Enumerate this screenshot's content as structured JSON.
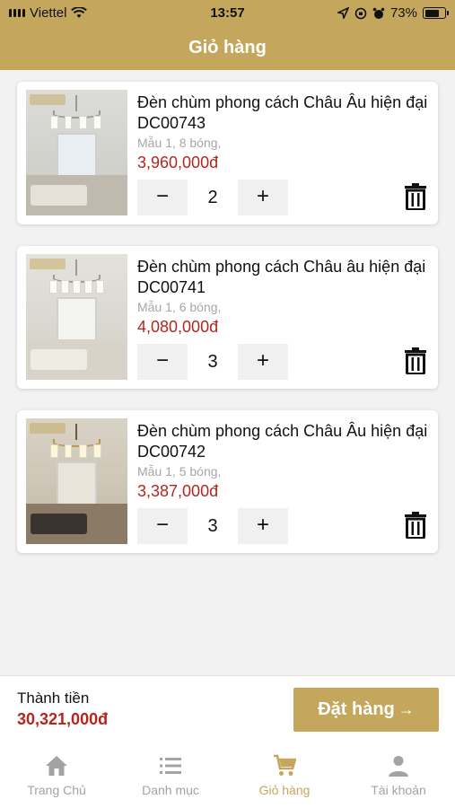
{
  "status": {
    "carrier": "Viettel",
    "time": "13:57",
    "battery": "73%",
    "battery_level": 0.73
  },
  "header": {
    "title": "Giỏ hàng"
  },
  "cart": {
    "items": [
      {
        "name": "Đèn chùm phong cách Châu Âu hiện đại DC00743",
        "variant": "Mẫu 1, 8 bóng,",
        "price": "3,960,000đ",
        "qty": "2",
        "minus": "−",
        "plus": "+"
      },
      {
        "name": "Đèn chùm phong cách Châu âu hiện đại DC00741",
        "variant": "Mẫu 1, 6 bóng,",
        "price": "4,080,000đ",
        "qty": "3",
        "minus": "−",
        "plus": "+"
      },
      {
        "name": "Đèn chùm phong cách Châu Âu hiện đại DC00742",
        "variant": "Mẫu 1, 5 bóng,",
        "price": "3,387,000đ",
        "qty": "3",
        "minus": "−",
        "plus": "+"
      }
    ]
  },
  "summary": {
    "total_label": "Thành tiền",
    "total_value": "30,321,000đ",
    "order_label": "Đặt hàng",
    "order_arrow": "→"
  },
  "tabs": [
    {
      "label": "Trang Chủ",
      "icon": "home-icon"
    },
    {
      "label": "Danh mục",
      "icon": "list-icon"
    },
    {
      "label": "Giỏ hàng",
      "icon": "cart-icon",
      "active": true
    },
    {
      "label": "Tài khoản",
      "icon": "user-icon"
    }
  ],
  "colors": {
    "brand": "#c4a75c",
    "price": "#b3261e",
    "muted": "#a3a3a3"
  }
}
